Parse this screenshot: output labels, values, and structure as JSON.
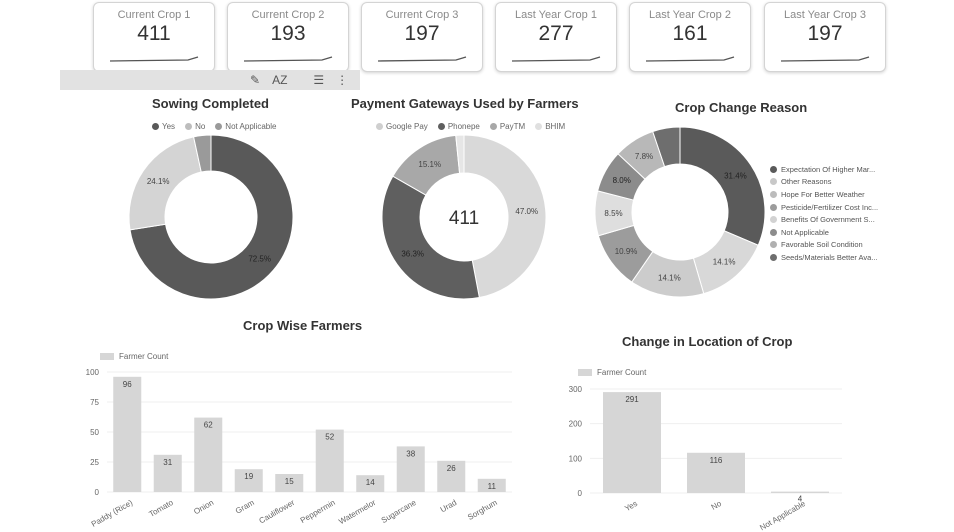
{
  "kpis": [
    {
      "label": "Current Crop 1",
      "value": "411"
    },
    {
      "label": "Current Crop 2",
      "value": "193"
    },
    {
      "label": "Current Crop 3",
      "value": "197"
    },
    {
      "label": "Last Year Crop 1",
      "value": "277"
    },
    {
      "label": "Last Year Crop 2",
      "value": "161"
    },
    {
      "label": "Last Year Crop 3",
      "value": "197"
    }
  ],
  "toolbar": {
    "sort_label": "AZ"
  },
  "colors": {
    "dark": "#595959",
    "medium": "#a6a6a6",
    "light": "#d9d9d9",
    "bar": "#d6d6d6"
  },
  "chart_data": [
    {
      "type": "pie",
      "title": "Sowing Completed",
      "labels": [
        "Yes",
        "No",
        "Not Applicable"
      ],
      "values": [
        72.5,
        24.1,
        3.4
      ],
      "value_labels": [
        "72.5%",
        "24.1%",
        ""
      ],
      "colors": [
        "#595959",
        "#d4d4d4",
        "#9a9a9a"
      ],
      "legend": "top"
    },
    {
      "type": "pie",
      "title": "Payment Gateways Used by Farmers",
      "labels": [
        "Google Pay",
        "Phonepe",
        "PayTM",
        "BHIM"
      ],
      "values": [
        47.0,
        36.3,
        15.1,
        1.6
      ],
      "value_labels": [
        "47.0%",
        "36.3%",
        "15.1%",
        ""
      ],
      "colors": [
        "#d9d9d9",
        "#5f5f5f",
        "#a8a8a8",
        "#e6e6e6"
      ],
      "center_label": "411",
      "legend": "top"
    },
    {
      "type": "pie",
      "title": "Crop Change Reason",
      "labels": [
        "Expectation Of Higher Mar...",
        "Other Reasons",
        "Hope For Better Weather",
        "Pesticide/Fertilizer Cost Inc...",
        "Benefits Of Government S...",
        "Not Applicable",
        "Favorable Soil Condition",
        "Seeds/Materials Better Ava..."
      ],
      "values": [
        31.4,
        14.1,
        14.1,
        10.9,
        8.5,
        8.0,
        7.8,
        5.2
      ],
      "value_labels": [
        "31.4%",
        "14.1%",
        "14.1%",
        "10.9%",
        "8.5%",
        "8.0%",
        "7.8%",
        ""
      ],
      "colors": [
        "#5a5a5a",
        "#d8d8d8",
        "#cccccc",
        "#9c9c9c",
        "#dedede",
        "#8c8c8c",
        "#b8b8b8",
        "#6e6e6e"
      ],
      "legend": "right"
    },
    {
      "type": "bar",
      "title": "Crop Wise Farmers",
      "categories": [
        "Paddy (Rice)",
        "Tomato",
        "Onion",
        "Gram",
        "Cauliflower",
        "Peppermin",
        "Watermelor",
        "Sugarcane",
        "Urad",
        "Sorghum"
      ],
      "series": [
        {
          "name": "Farmer Count",
          "values": [
            96,
            31,
            62,
            19,
            15,
            52,
            14,
            38,
            26,
            11
          ]
        }
      ],
      "value_labels": [
        "96",
        "31",
        "62",
        "19",
        "15",
        "52",
        "14",
        "38",
        "26",
        "11"
      ],
      "yticks": [
        "0",
        "25",
        "50",
        "75",
        "100"
      ],
      "ylim": [
        0,
        100
      ]
    },
    {
      "type": "bar",
      "title": "Change in Location of Crop",
      "categories": [
        "Yes",
        "No",
        "Not Applicable"
      ],
      "series": [
        {
          "name": "Farmer Count",
          "values": [
            291,
            116,
            4
          ]
        }
      ],
      "value_labels": [
        "291",
        "116",
        "4"
      ],
      "yticks": [
        "0",
        "100",
        "200",
        "300"
      ],
      "ylim": [
        0,
        300
      ]
    }
  ]
}
